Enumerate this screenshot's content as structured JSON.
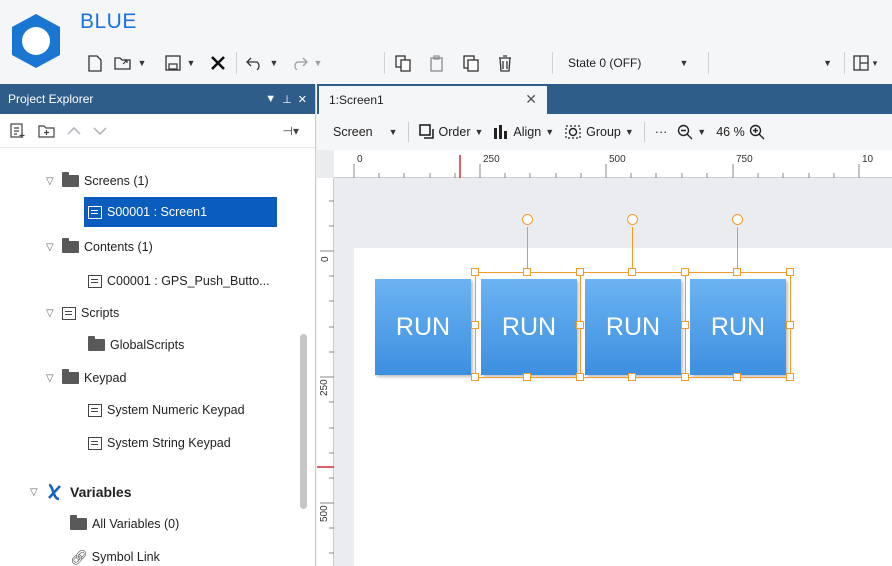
{
  "app": {
    "title": "BLUE"
  },
  "toolbar": {
    "state_label": "State 0 (OFF)",
    "icons": [
      "new-file-icon",
      "open-icon",
      "save-icon",
      "close-icon",
      "undo-icon",
      "redo-icon",
      "copy-icon",
      "paste-icon",
      "duplicate-icon",
      "delete-icon",
      "layout-icon"
    ]
  },
  "explorer": {
    "title": "Project Explorer",
    "items": [
      {
        "label": "Screens (1)"
      },
      {
        "label": "S00001 : Screen1"
      },
      {
        "label": "Contents (1)"
      },
      {
        "label": "C00001 : GPS_Push_Butto..."
      },
      {
        "label": "Scripts"
      },
      {
        "label": "GlobalScripts"
      },
      {
        "label": "Keypad"
      },
      {
        "label": "System Numeric Keypad"
      },
      {
        "label": "System String Keypad"
      },
      {
        "label": "Variables"
      },
      {
        "label": "All Variables (0)"
      },
      {
        "label": "Symbol Link"
      }
    ]
  },
  "editor": {
    "tab_label": "1:Screen1",
    "toolbar": {
      "screen_label": "Screen",
      "order_label": "Order",
      "align_label": "Align",
      "group_label": "Group",
      "more_label": "···",
      "zoom_label": "46 %"
    },
    "ruler_top": [
      "0",
      "250",
      "500",
      "750",
      "10"
    ],
    "ruler_left": [
      "0",
      "250",
      "500"
    ],
    "buttons": [
      {
        "label": "RUN"
      },
      {
        "label": "RUN"
      },
      {
        "label": "RUN"
      },
      {
        "label": "RUN"
      }
    ]
  },
  "colors": {
    "accent": "#1a73d9",
    "panel_header": "#2f5d8a",
    "selection": "#0a5dbd",
    "button": "#4a9be8",
    "handle": "#f39a2b"
  }
}
